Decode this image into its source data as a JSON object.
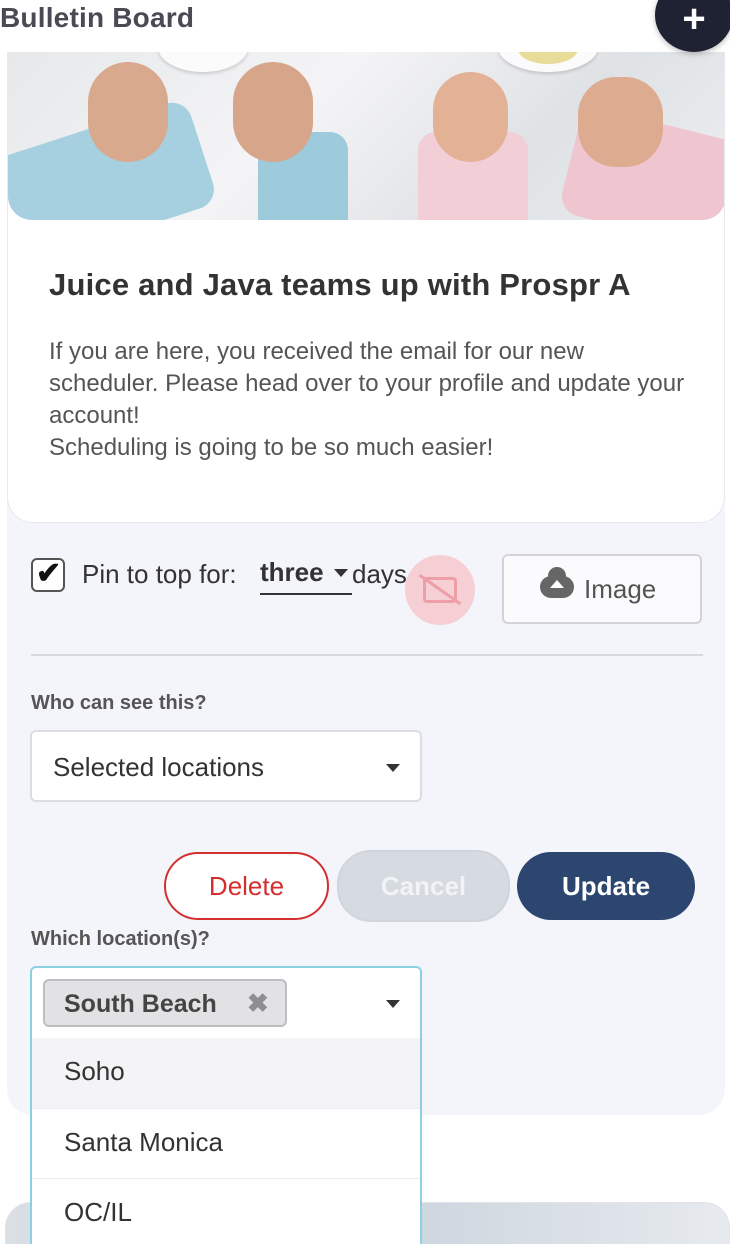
{
  "header": {
    "title": "Bulletin Board",
    "add_label": "+"
  },
  "post": {
    "title": "Juice and Java teams up with Prospr A",
    "body": [
      "If you are here, you received the email for our new scheduler. Please head over to your profile and update your account!",
      "Scheduling is going to be so much easier!"
    ]
  },
  "pin": {
    "checked": true,
    "check_glyph": "✔",
    "label": "Pin to top for:",
    "duration_value": "three",
    "suffix": "days"
  },
  "image_button": {
    "label": "Image",
    "icon": "cloud-upload-icon"
  },
  "visibility": {
    "label": "Who can see this?",
    "selected": "Selected locations"
  },
  "actions": {
    "delete_label": "Delete",
    "cancel_label": "Cancel",
    "update_label": "Update"
  },
  "locations": {
    "label": "Which location(s)?",
    "selected_chips": [
      {
        "label": "South Beach",
        "remove_glyph": "✖"
      }
    ],
    "options": [
      {
        "label": "Soho",
        "highlighted": true
      },
      {
        "label": "Santa Monica",
        "highlighted": false
      },
      {
        "label": "OC/IL",
        "highlighted": false
      }
    ]
  },
  "colors": {
    "primary": "#2c4670",
    "danger": "#d32f2f",
    "fab": "#1f2233",
    "focus_border": "#8ad0e0"
  }
}
